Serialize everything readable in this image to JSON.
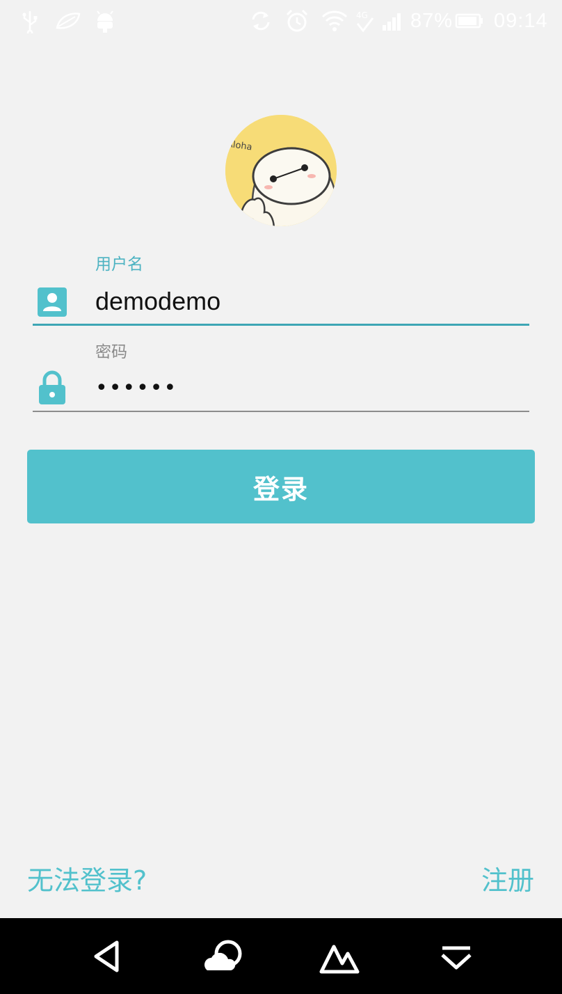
{
  "status_bar": {
    "battery_percent": "87%",
    "time": "09:14",
    "icons": [
      "usb-icon",
      "leaf-icon",
      "android-icon",
      "sync-icon",
      "alarm-icon",
      "wifi-icon",
      "network-4g-icon",
      "signal-icon",
      "battery-icon"
    ]
  },
  "avatar": {
    "caption": "Aloha"
  },
  "login_form": {
    "username": {
      "label": "用户名",
      "value": "demodemo",
      "icon": "account-icon"
    },
    "password": {
      "label": "密码",
      "value": "••••••",
      "icon": "lock-icon"
    },
    "submit_label": "登录"
  },
  "footer": {
    "forgot_label": "无法登录?",
    "register_label": "注册"
  },
  "nav_bar": {
    "icons": [
      "back-icon",
      "cloud-icon",
      "home-icon",
      "menu-down-icon"
    ]
  },
  "colors": {
    "accent": "#52c1cc",
    "accent_dark": "#3ea6b5",
    "background": "#f2f2f2"
  }
}
